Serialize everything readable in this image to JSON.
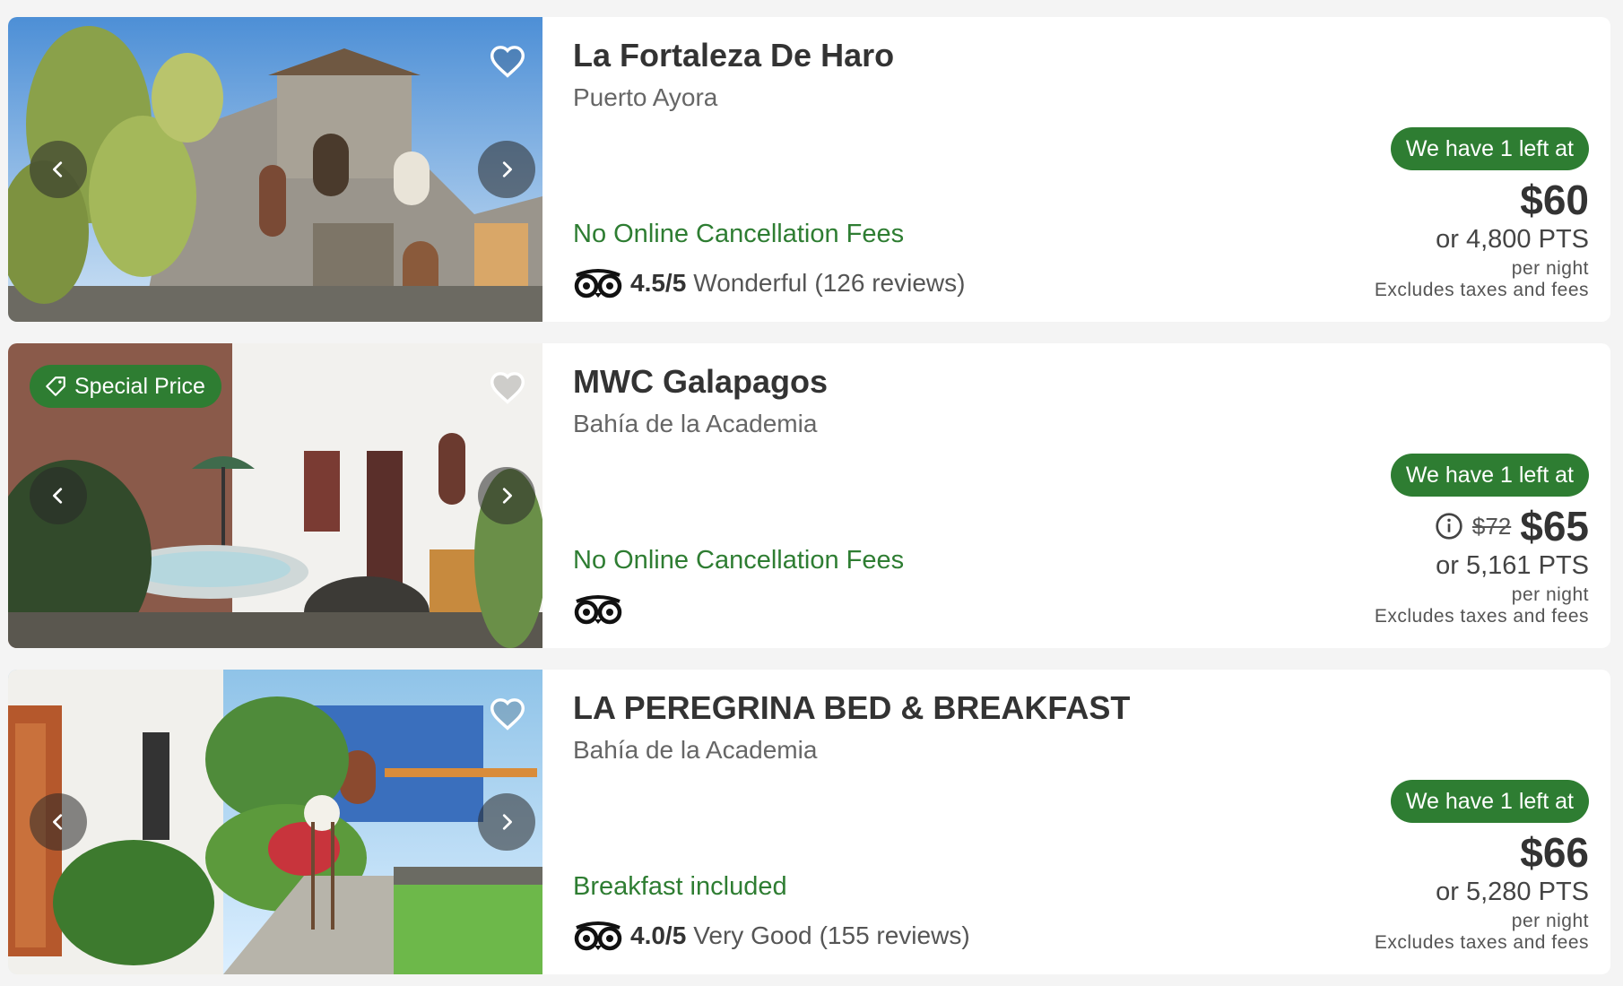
{
  "colors": {
    "accent_green": "#2e7d32",
    "text_dark": "#333333",
    "text_muted": "#666666",
    "page_bg": "#f4f4f4"
  },
  "icons": {
    "favorite": "heart-outline-icon",
    "prev": "chevron-left-icon",
    "next": "chevron-right-icon",
    "rating": "tripadvisor-owl-icon",
    "special": "price-tag-icon",
    "info": "info-circle-icon"
  },
  "listings": [
    {
      "name": "La Fortaleza De Haro",
      "area": "Puerto Ayora",
      "perk": "No Online Cancellation Fees",
      "rating_score": "4.5/5",
      "rating_label": "Wonderful",
      "rating_reviews": "(126 reviews)",
      "availability": "We have 1 left at",
      "price": "$60",
      "original_price": "",
      "points": "or 4,800 PTS",
      "per_night": "per night",
      "tax_note": "Excludes taxes and fees"
    },
    {
      "name": "MWC Galapagos",
      "area": "Bahía de la Academia",
      "special_badge": "Special Price",
      "perk": "No Online Cancellation Fees",
      "rating_score": "",
      "rating_label": "",
      "rating_reviews": "",
      "availability": "We have 1 left at",
      "price": "$65",
      "original_price": "$72",
      "points": "or 5,161 PTS",
      "per_night": "per night",
      "tax_note": "Excludes taxes and fees"
    },
    {
      "name": "LA PEREGRINA BED & BREAKFAST",
      "area": "Bahía de la Academia",
      "perk": "Breakfast included",
      "rating_score": "4.0/5",
      "rating_label": "Very Good",
      "rating_reviews": "(155 reviews)",
      "availability": "We have 1 left at",
      "price": "$66",
      "original_price": "",
      "points": "or 5,280 PTS",
      "per_night": "per night",
      "tax_note": "Excludes taxes and fees"
    }
  ]
}
